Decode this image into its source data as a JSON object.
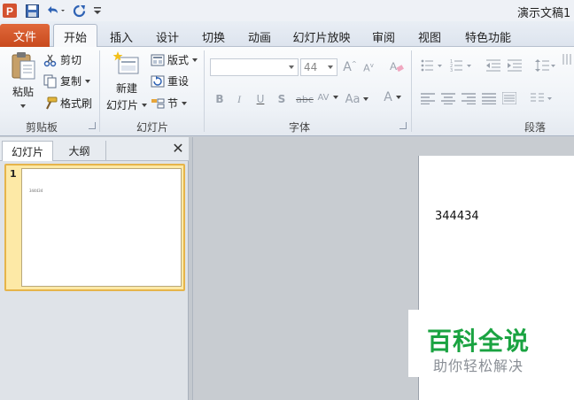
{
  "window": {
    "title": "演示文稿1 -"
  },
  "tabs": {
    "file": "文件",
    "items": [
      "开始",
      "插入",
      "设计",
      "切换",
      "动画",
      "幻灯片放映",
      "审阅",
      "视图",
      "特色功能"
    ]
  },
  "clipboard": {
    "paste": "粘贴",
    "cut": "剪切",
    "copy": "复制",
    "format_painter": "格式刷",
    "label": "剪贴板"
  },
  "slides_group": {
    "new_slide_top": "新建",
    "new_slide_bottom": "幻灯片",
    "layout": "版式",
    "reset": "重设",
    "section": "节",
    "label": "幻灯片"
  },
  "font_group": {
    "font_size": "44",
    "label": "字体"
  },
  "paragraph_group": {
    "label": "段落"
  },
  "panel": {
    "tab_slides": "幻灯片",
    "tab_outline": "大纲",
    "close": "✕",
    "slide_number": "1",
    "thumb_text": "344434"
  },
  "slide": {
    "text": "344434"
  },
  "watermark": {
    "title": "百科全说",
    "subtitle": "助你轻松解决"
  },
  "colors": {
    "file_tab": "#d0562a",
    "accent_orange": "#e6b44a",
    "watermark_green": "#1aa341"
  }
}
